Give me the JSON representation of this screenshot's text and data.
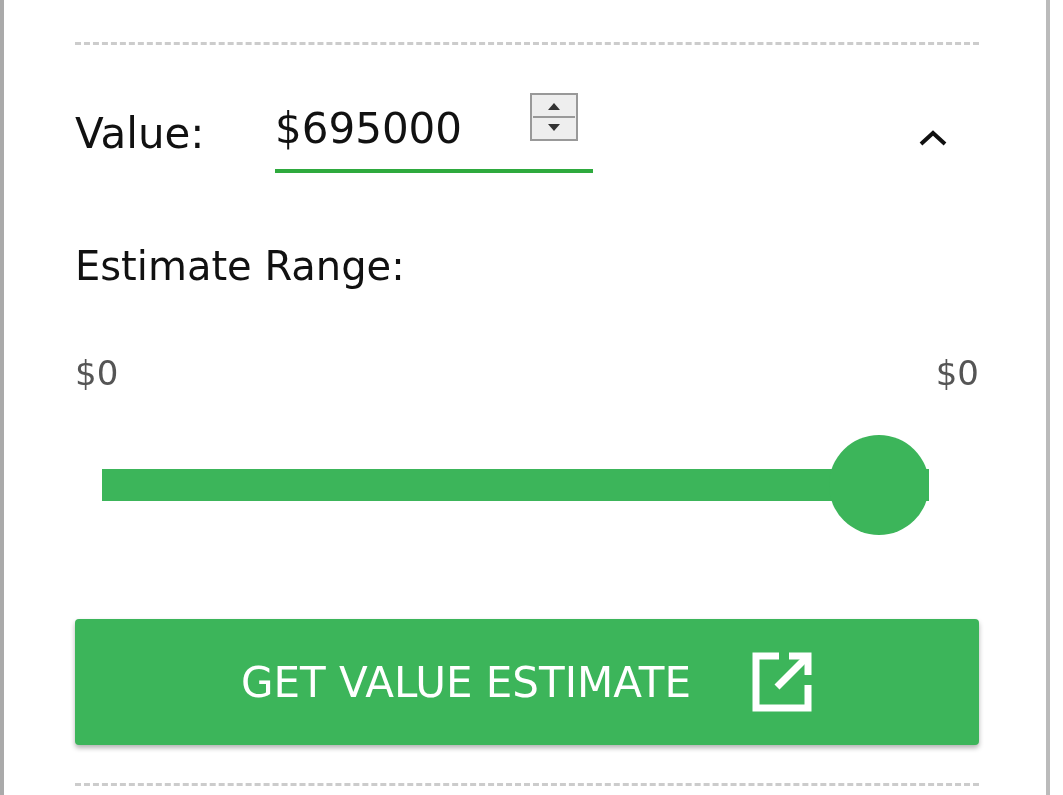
{
  "value_field": {
    "label": "Value:",
    "value": "$695000",
    "expanded": true
  },
  "estimate": {
    "label": "Estimate Range:",
    "min_label": "$0",
    "max_label": "$0",
    "level": 1
  },
  "button": {
    "label": "GET VALUE ESTIMATE"
  }
}
